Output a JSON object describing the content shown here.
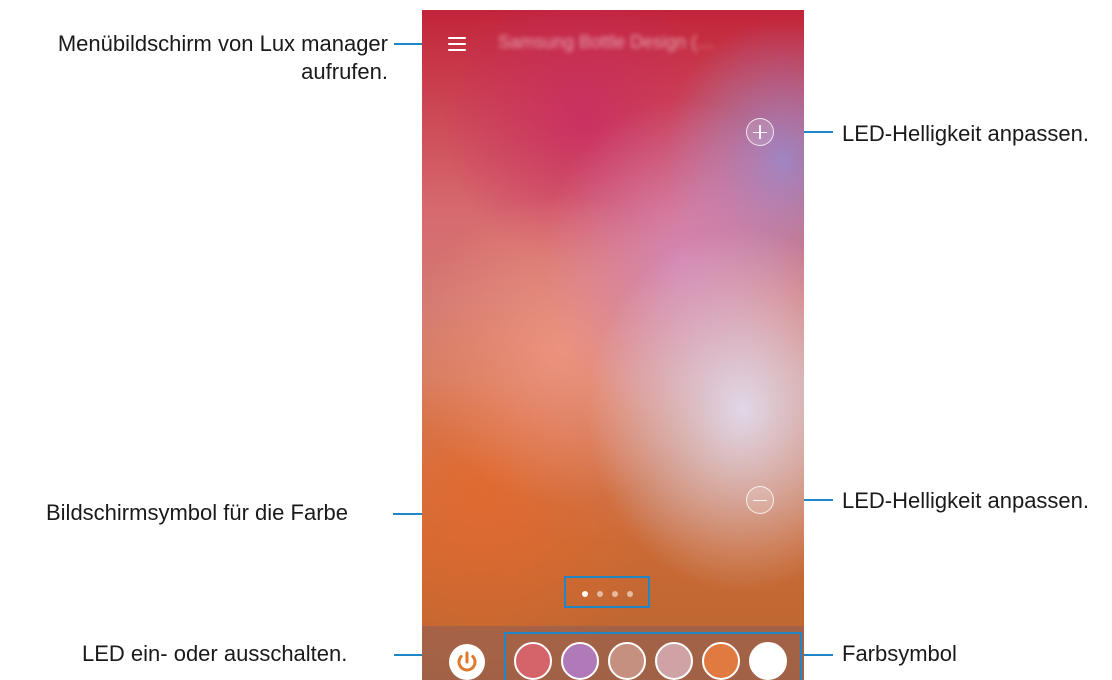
{
  "app": {
    "title": "Samsung Bottle Design (…"
  },
  "callouts": {
    "menu": "Menübildschirm von Lux manager aufrufen.",
    "brightness_up": "LED-Helligkeit anpassen.",
    "brightness_down": "LED-Helligkeit anpassen.",
    "page_indicator": "Bildschirmsymbol für die Farbe",
    "power": "LED ein- oder ausschalten.",
    "color_icons": "Farbsymbol"
  },
  "icons": {
    "menu": "menu-icon",
    "brightness_up": "plus-icon",
    "brightness_down": "minus-icon",
    "power": "power-icon"
  },
  "pager": {
    "count": 4,
    "active_index": 0
  },
  "colors": {
    "accent_callout": "#1f86c8",
    "power_icon": "#e07a2b",
    "swatches": [
      "#d4636a",
      "#b07ab8",
      "#c59080",
      "#cfa2a6",
      "#e07a40",
      "#ffffff"
    ]
  }
}
